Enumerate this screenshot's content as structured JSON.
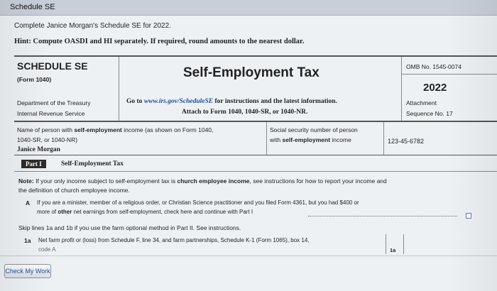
{
  "window": {
    "title": "Schedule SE"
  },
  "instructions": {
    "line1": "Complete Janice Morgan's Schedule SE for 2022.",
    "hint": "Hint: Compute OASDI and HI separately. If required, round amounts to the nearest dollar."
  },
  "form": {
    "name": "SCHEDULE SE",
    "form_ref": "(Form 1040)",
    "title": "Self-Employment Tax",
    "omb": "OMB No. 1545-0074",
    "year": "2022",
    "attachment": "Attachment",
    "sequence": "Sequence No. 17",
    "dept_line1": "Department of the Treasury",
    "dept_line2": "Internal Revenue Service",
    "goto_prefix": "Go to",
    "goto_link": "www.irs.gov/ScheduleSE",
    "goto_suffix": "for instructions and the latest information.",
    "attach_line": "Attach to Form 1040, 1040-SR, or 1040-NR."
  },
  "taxpayer": {
    "name_label_line1_pre": "Name of person with ",
    "name_label_line1_bold": "self-employment",
    "name_label_line1_post": " income (as shown on Form 1040,",
    "name_label_line2": "1040-SR, or 1040-NR)",
    "name": "Janice Morgan",
    "ssn_label_line1": "Social security number of person",
    "ssn_label_line2_pre": "with ",
    "ssn_label_line2_bold": "self-employment",
    "ssn_label_line2_post": " income",
    "ssn": "123-45-6782"
  },
  "part1": {
    "tag": "Part I",
    "title": "Self-Employment Tax",
    "note_label": "Note:",
    "note_pre": " If your only income subject to self-employment tax is ",
    "note_bold": "church employee income",
    "note_post": ", see instructions for how to report your income and",
    "note_line2": "the definition of church employee income.",
    "lineA_label": "A",
    "lineA_text1": "If you are a minister, member of a religious order, or Christian Science practitioner and you filed Form 4361, but you had $400 or",
    "lineA_text2_pre": "more of ",
    "lineA_text2_bold": "other",
    "lineA_text2_post": " net earnings from self-employment, check here and continue with Part I",
    "skip_text": "Skip lines 1a and 1b if you use the farm optional method in Part II. See instructions.",
    "line1a_label": "1a",
    "line1a_text": "Net farm profit or (loss) from Schedule F, line 34, and farm partnerships, Schedule K-1 (Form 1065), box 14,",
    "line1a_text2": "code A",
    "line1a_box": "1a"
  },
  "buttons": {
    "check_my_work": "Check My Work"
  }
}
